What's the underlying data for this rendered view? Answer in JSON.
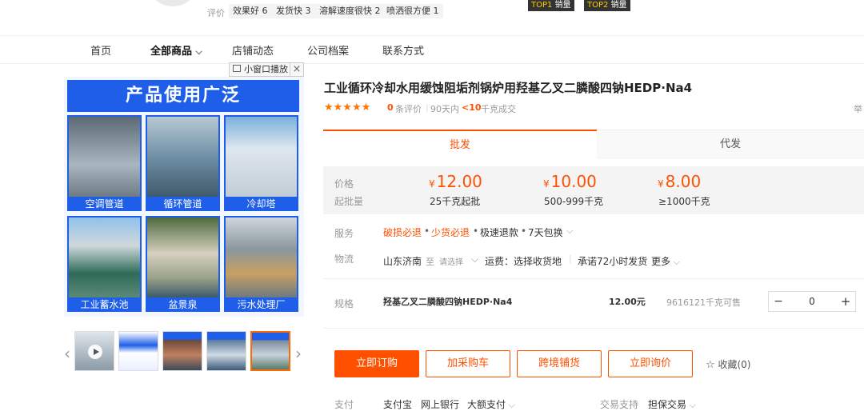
{
  "header": {
    "review_label": "评价",
    "tags": [
      "效果好 6",
      "发货快 3",
      "溶解速度很快 2",
      "喷洒很方便 1"
    ],
    "badges": [
      {
        "rank": "TOP1",
        "label": "销量"
      },
      {
        "rank": "TOP2",
        "label": "销量"
      }
    ]
  },
  "nav": {
    "items": [
      "首页",
      "全部商品",
      "店铺动态",
      "公司档案",
      "联系方式"
    ],
    "active_chevron": "⌵"
  },
  "gallery": {
    "mini_window_label": "小窗口播放",
    "close_glyph": "×",
    "banner": "产品使用广泛",
    "photos": [
      {
        "caption": "空调管道",
        "color": "#8a9aa8"
      },
      {
        "caption": "循环管道",
        "color": "#7fa0b5"
      },
      {
        "caption": "冷却塔",
        "color": "#c3d3df"
      },
      {
        "caption": "工业蓄水池",
        "color": "#3f6f5c"
      },
      {
        "caption": "盆景泉",
        "color": "#8b9f7a"
      },
      {
        "caption": "污水处理厂",
        "color": "#9aa6ae"
      }
    ],
    "prev_arrow": "‹",
    "next_arrow": "›"
  },
  "product": {
    "title": "工业循环冷却水用缓蚀阻垢剂锅炉用羟基乙叉二膦酸四钠HEDP·Na4",
    "stars": "★★★★★",
    "review_count": "0",
    "review_suffix": "条评价",
    "sales_prefix": "90天内",
    "sales_value": "<10",
    "sales_suffix": "千克成交",
    "right_edge_text": "举"
  },
  "tabs": {
    "wholesale": "批发",
    "proxy": "代发"
  },
  "pricing": {
    "price_label": "价格",
    "moq_label": "起批量",
    "currency": "¥",
    "tiers": [
      {
        "price": "12.00",
        "range": "25千克起批"
      },
      {
        "price": "10.00",
        "range": "500-999千克"
      },
      {
        "price": "8.00",
        "range": "≥1000千克"
      }
    ]
  },
  "service": {
    "label": "服务",
    "items": [
      "破损必退",
      "少货必退",
      "极速退款",
      "7天包换"
    ],
    "separator": "•",
    "chevron": "⌵"
  },
  "logistics": {
    "label": "物流",
    "from": "山东济南",
    "to_word": "至",
    "select_placeholder": "请选择",
    "freight": "运费：选择收货地",
    "promise": "承诺72小时发货",
    "more": "更多"
  },
  "spec": {
    "label": "规格",
    "name": "羟基乙叉二膦酸四钠HEDP·Na4",
    "price": "12.00元",
    "stock": "9616121千克可售",
    "minus": "−",
    "qty": "0",
    "plus": "+"
  },
  "actions": {
    "order": "立即订购",
    "cart": "加采购车",
    "crossborder": "跨境铺货",
    "inquiry": "立即询价",
    "favorite": "收藏(0)",
    "star_glyph": "☆"
  },
  "payment": {
    "label": "支付",
    "methods": [
      "支付宝",
      "网上银行",
      "大额支付"
    ],
    "trade_label": "交易支持",
    "trade_value": "担保交易"
  },
  "colors": {
    "accent": "#ff5000",
    "banner_blue": "#1e5ee8"
  }
}
